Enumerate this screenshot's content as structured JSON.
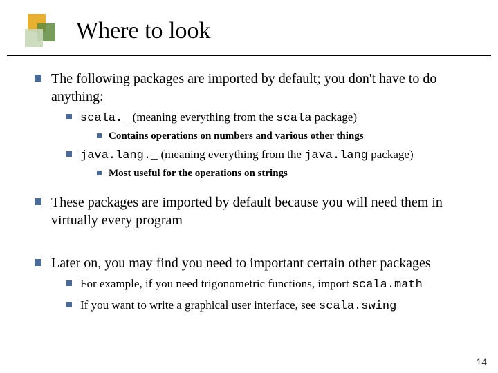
{
  "title": "Where to look",
  "bullets": {
    "p1": "The following packages are imported by default; you don't have to do anything:",
    "p1a_code": "scala._",
    "p1a_rest": "   (meaning everything from the ",
    "p1a_code2": "scala",
    "p1a_end": " package)",
    "p1a_sub": "Contains operations on numbers and various other things",
    "p1b_code": "java.lang._",
    "p1b_rest": "   (meaning everything from the ",
    "p1b_code2": "java.lang",
    "p1b_end": " package)",
    "p1b_sub": "Most useful for the operations on strings",
    "p2": "These packages are imported by default because you will need them in virtually every program",
    "p3": "Later on, you may find you need to important certain other packages",
    "p3a_pre": "For example, if you need trigonometric functions, import ",
    "p3a_code": "scala.math",
    "p3b_pre": "If you want to write a graphical user interface, see  ",
    "p3b_code": "scala.swing"
  },
  "page_number": "14"
}
